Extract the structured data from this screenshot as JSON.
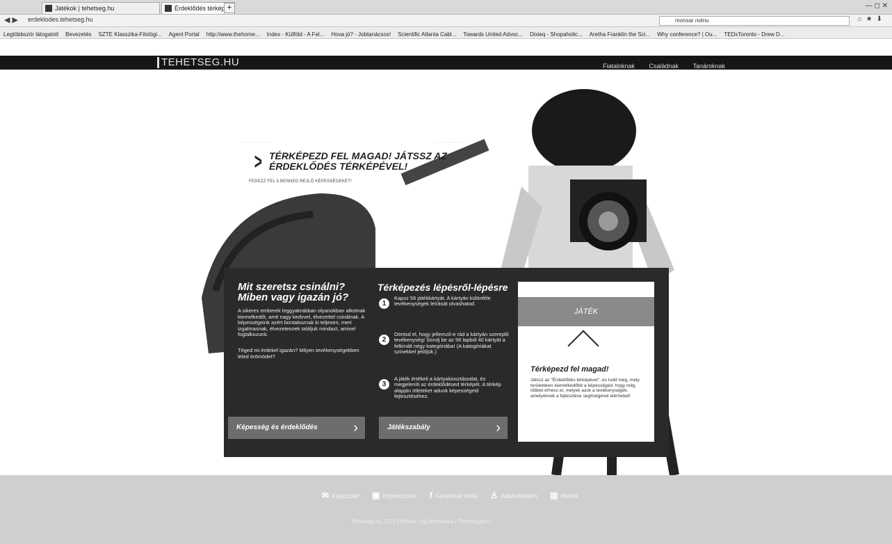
{
  "browser": {
    "tabs": [
      {
        "label": "Játékok | tehetseg.hu"
      },
      {
        "label": "Érdeklődés térképe"
      }
    ],
    "newtab_label": "+",
    "window_controls": "— ◻ ✕",
    "url": "erdeklodes.tehetseg.hu",
    "search_value": "monsar nolnu",
    "bookmarks": [
      "Legtöbbször látogatott",
      "Bevezetés",
      "SZTE Klasszika-Filológi...",
      "Agent Portal",
      "http://www.thehome...",
      "Index - Külföld - A Fel...",
      "Hova jó? - Jobtanácsos!",
      "Scientific Atlanta Cabl...",
      "Towards United Advoc...",
      "Dixieq - Shopaholic...",
      "Aretha Franklin the Sci...",
      "Why conference? | Ou...",
      "TEDxToronto - Drew D..."
    ]
  },
  "site": {
    "logo": "TEHETSEG.HU",
    "nav": [
      "Fiataloknak",
      "Családnak",
      "Tanároknak"
    ],
    "hero": {
      "heading": "TÉRKÉPEZD FEL MAGAD! JÁTSSZ AZ ÉRDEKLŐDÉS TÉRKÉPÉVEL!",
      "subheading": "FEDEZZ FEL A BENNED REJLŐ KÉPESSÉGEKET!"
    },
    "intro": {
      "title": "Mit szeretsz csinálni? Miben vagy igazán jó?",
      "p1": "A sikeres emberek leggyakrabban olyanokban alkotnak kiemelkedőt, amit nagy kedvvel, élvezettel csinálnak. A képességeink azért bontakoznak ki teljesen, mert izgalmasnak, élvezetesnek találjuk mindazt, amivel foglalkozunk.",
      "p2": "Téged mi érdekel igazán? Milyen tevékenységekben leled örömödet?",
      "button": "Képesség és érdeklődés"
    },
    "steps": {
      "title": "Térképezés lépésről-lépésre",
      "items": [
        {
          "num": "1",
          "text": "Kapsz 56 játékkártyát. A kártyán különféle tevékenységek leírását olvashatod."
        },
        {
          "num": "2",
          "text": "Döntsd el, hogy jellemző-e rád a kártyán szereplő tevékenység! Sorolj be az 56 lapból 40 kártyát a felkínált négy kategóriába! (A kategóriákat színekkel jelöljük.)"
        },
        {
          "num": "3",
          "text": "A játék értékeli a kártyakiosztásodat, és megjeleníti az érdeklődésed térképét. A térkép alapján ötleteket adunk képességeid fejlesztéséhez."
        }
      ],
      "button": "Játékszabály"
    },
    "card": {
      "band": "JÁTÉK",
      "title": "Térképezd fel magad!",
      "text": "Játssz az \"Érdeklődés térképével\", és tudd meg, mely területeken kiemelkedőbb a képességed, hogy még többet érhess el, melyek azok a tevékenységek, amelyeknek a fejlesztése segítségével elérheted!"
    },
    "footer": {
      "links": [
        {
          "icon": "✉",
          "label": "Kapcsolat"
        },
        {
          "icon": "▣",
          "label": "Impresszum"
        },
        {
          "icon": "f",
          "label": "Facebook oldal"
        },
        {
          "icon": "♙",
          "label": "Adatvédelem"
        },
        {
          "icon": "▤",
          "label": "Média"
        }
      ],
      "copyright": "Tehetség.hu 2013 | Minden jog fenntartva | Tehetségpont"
    }
  }
}
